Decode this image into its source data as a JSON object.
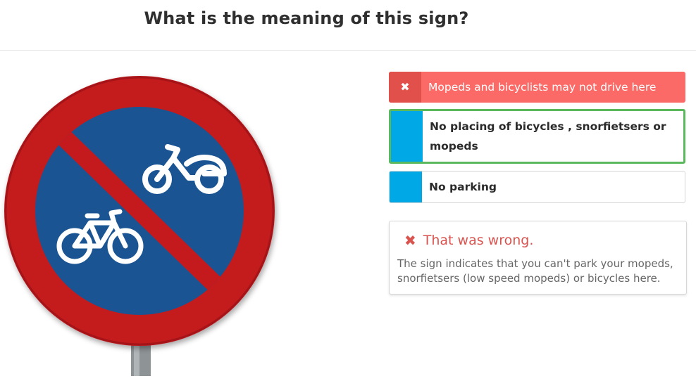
{
  "question": "What is the meaning of this sign?",
  "sign": {
    "image_name": "no-bicycles-mopeds-parking-sign",
    "colors": {
      "ring": "#c41a1e",
      "field": "#1a5493",
      "symbol": "#ffffff"
    }
  },
  "answers": [
    {
      "label": "Mopeds and bicyclists may not drive here",
      "state": "selected-wrong",
      "marker": "✖"
    },
    {
      "label": "No placing of bicycles , snorfietsers or mopeds",
      "state": "correct",
      "marker": ""
    },
    {
      "label": "No parking",
      "state": "neutral",
      "marker": ""
    }
  ],
  "feedback": {
    "icon": "✖",
    "title": "That was wrong.",
    "explanation": "The sign indicates that you can't park your mopeds, snorfietsers (low speed mopeds) or bicycles here."
  },
  "colors": {
    "wrong": "#fb6a66",
    "wrong_dark": "#e2504c",
    "correct_border": "#5cb85c",
    "marker_blue": "#00a8e6",
    "feedback_red": "#d9534f"
  }
}
